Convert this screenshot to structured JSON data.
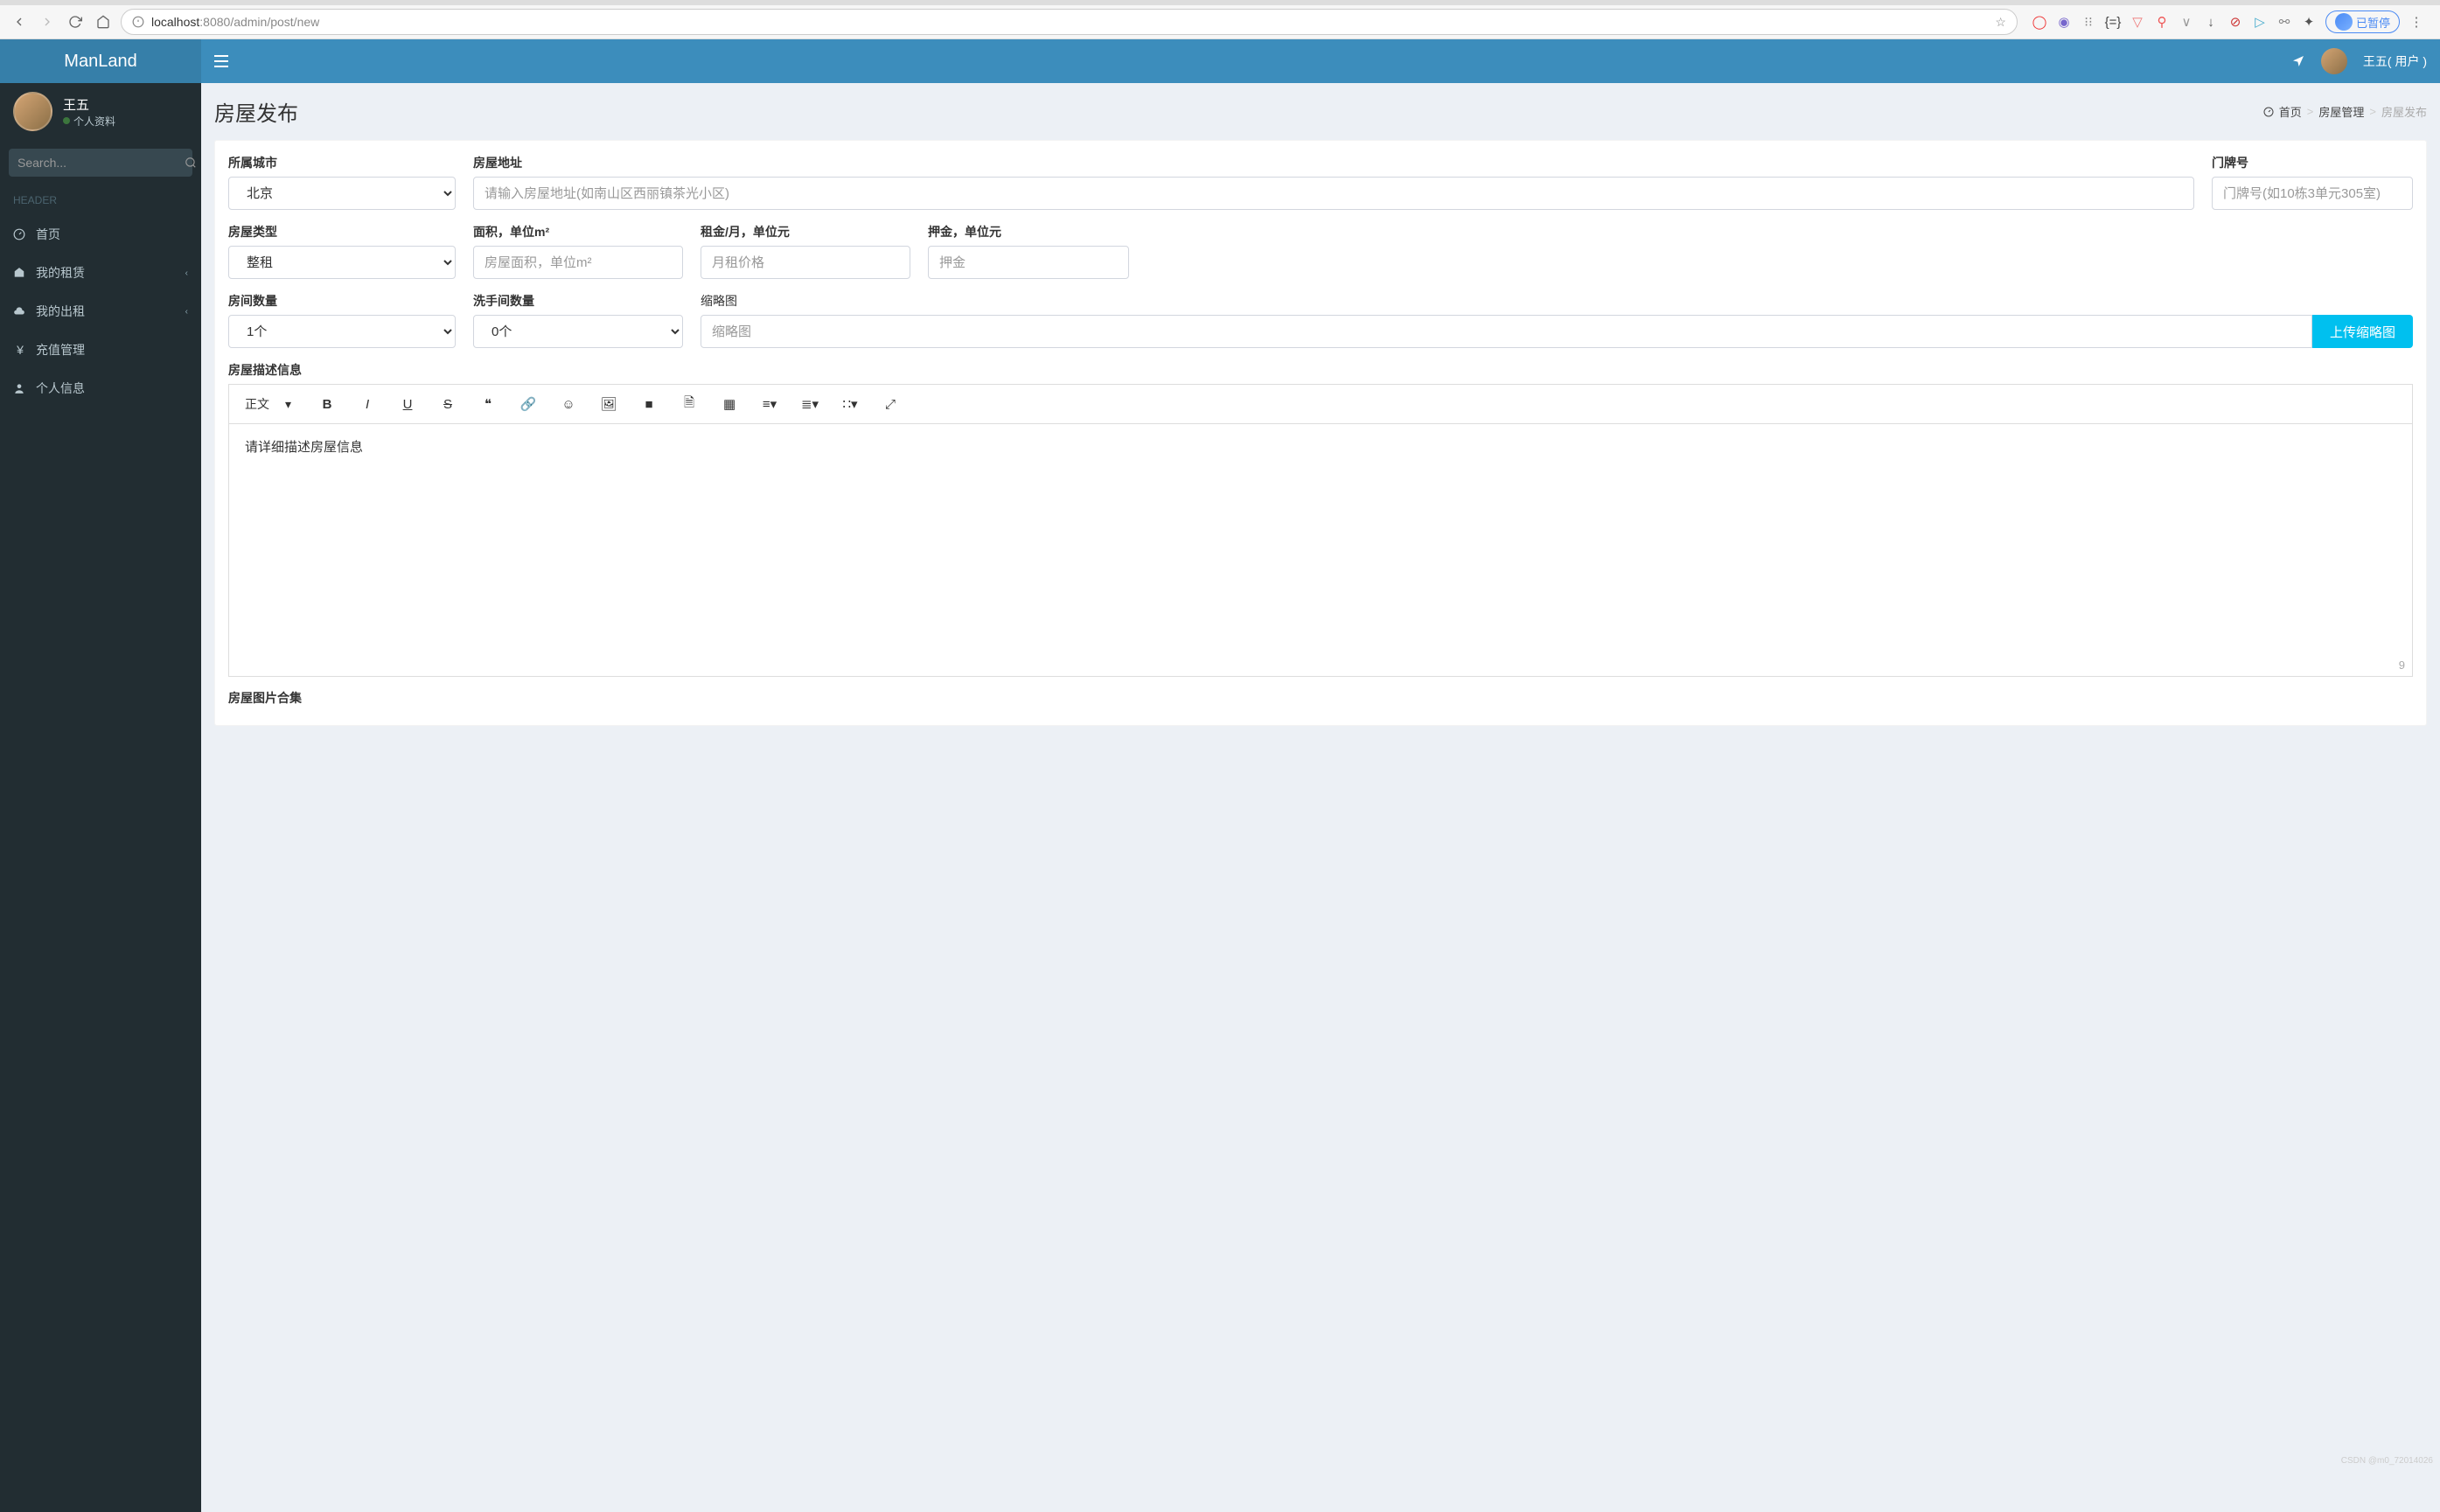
{
  "browser": {
    "url_host": "localhost",
    "url_port": ":8080",
    "url_path": "/admin/post/new",
    "pause_label": "已暂停"
  },
  "app": {
    "brand": "ManLand",
    "header_user": "王五( 用户 )"
  },
  "user_panel": {
    "name": "王五",
    "sub": "个人资料"
  },
  "search": {
    "placeholder": "Search..."
  },
  "nav": {
    "header": "HEADER",
    "items": [
      {
        "icon": "dashboard",
        "label": "首页"
      },
      {
        "icon": "home",
        "label": "我的租赁",
        "chev": true
      },
      {
        "icon": "cloud",
        "label": "我的出租",
        "chev": true
      },
      {
        "icon": "yen",
        "label": "充值管理"
      },
      {
        "icon": "user",
        "label": "个人信息"
      }
    ]
  },
  "page": {
    "title": "房屋发布",
    "breadcrumb": {
      "home": "首页",
      "mid": "房屋管理",
      "current": "房屋发布"
    }
  },
  "form": {
    "city": {
      "label": "所属城市",
      "value": "北京"
    },
    "address": {
      "label": "房屋地址",
      "placeholder": "请输入房屋地址(如南山区西丽镇茶光小区)"
    },
    "door": {
      "label": "门牌号",
      "placeholder": "门牌号(如10栋3单元305室)"
    },
    "type": {
      "label": "房屋类型",
      "value": "整租"
    },
    "area": {
      "label": "面积，单位m²",
      "placeholder": "房屋面积，单位m²"
    },
    "rent": {
      "label": "租金/月，单位元",
      "placeholder": "月租价格"
    },
    "deposit": {
      "label": "押金，单位元",
      "placeholder": "押金"
    },
    "rooms": {
      "label": "房间数量",
      "value": "1个"
    },
    "baths": {
      "label": "洗手间数量",
      "value": "0个"
    },
    "thumb": {
      "label": "缩略图",
      "placeholder": "缩略图",
      "button": "上传缩略图"
    },
    "desc": {
      "label": "房屋描述信息",
      "placeholder": "请详细描述房屋信息",
      "style_label": "正文",
      "char_count": "9"
    },
    "gallery": {
      "label": "房屋图片合集"
    }
  },
  "watermark": "CSDN @m0_72014026"
}
